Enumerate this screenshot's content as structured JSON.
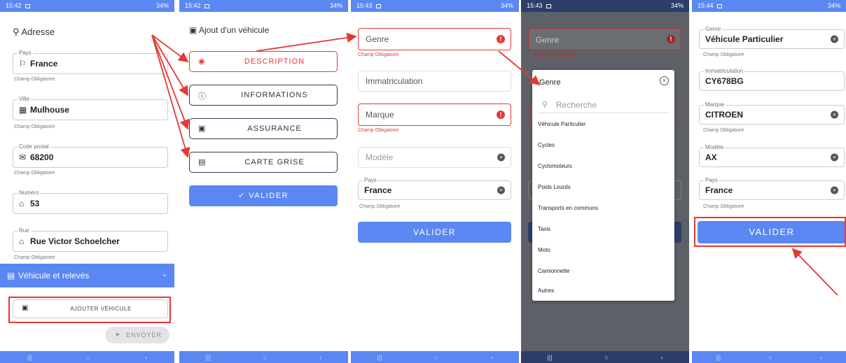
{
  "colors": {
    "primary": "#5b87f2",
    "error": "#e53935",
    "dark_status": "#2c3d6a"
  },
  "screen1": {
    "status": {
      "time": "15:42",
      "right": "34%"
    },
    "section_title": "Adresse",
    "pays": {
      "label": "Pays",
      "value": "France",
      "icon": "flag-icon",
      "hint": "Champ Obligatoire"
    },
    "ville": {
      "label": "Ville",
      "value": "Mulhouse",
      "icon": "building-icon",
      "hint": "Champ Obligatoire"
    },
    "code_postal": {
      "label": "Code postal",
      "value": "68200",
      "icon": "mail-icon",
      "hint": "Champ Obligatoire"
    },
    "numero": {
      "label": "Numéro",
      "value": "53",
      "icon": "home-icon"
    },
    "rue": {
      "label": "Rue",
      "value": "Rue Victor Schoelcher",
      "icon": "home-icon",
      "hint": "Champ Obligatoire"
    },
    "vehicle_section": "Véhicule et relevés",
    "add_vehicle_button": "AJOUTER VÉHICULE",
    "send_button": "ENVOYER"
  },
  "screen2": {
    "status": {
      "time": "15:42",
      "right": "34%"
    },
    "title": "Ajout d'un véhicule",
    "menu": [
      {
        "label": "DESCRIPTION",
        "icon": "eye-icon",
        "active": true
      },
      {
        "label": "INFORMATIONS",
        "icon": "info-icon",
        "active": false
      },
      {
        "label": "ASSURANCE",
        "icon": "car-icon",
        "active": false
      },
      {
        "label": "CARTE GRISE",
        "icon": "document-icon",
        "active": false
      }
    ],
    "validate_button": "VALIDER"
  },
  "screen3": {
    "status": {
      "time": "15:43",
      "right": "34%"
    },
    "genre": {
      "placeholder": "Genre",
      "error": "Champ Obligatoire"
    },
    "immatriculation": {
      "placeholder": "Immatriculation"
    },
    "marque": {
      "placeholder": "Marque",
      "error": "Champ Obligatoire"
    },
    "modele": {
      "placeholder": "Modèle"
    },
    "pays": {
      "label": "Pays",
      "value": "France",
      "hint": "Champ Obligatoire"
    },
    "validate_button": "VALIDER"
  },
  "screen4": {
    "status": {
      "time": "15:43",
      "right": "34%"
    },
    "background_field": "Genre",
    "background_error": "Champ Obligatoire",
    "dialog_title": "Genre",
    "search_placeholder": "Recherche",
    "options": [
      "Véhicule Particulier",
      "Cycles",
      "Cyclomoteurs",
      "Poids Lourds",
      "Transports en communs",
      "Taxis",
      "Moto",
      "Camionnette",
      "Autres"
    ]
  },
  "screen5": {
    "status": {
      "time": "15:44",
      "right": "34%"
    },
    "genre": {
      "label": "Genre",
      "value": "Véhicule Particulier",
      "hint": "Champ Obligatoire"
    },
    "immatriculation": {
      "label": "Immatriculation",
      "value": "CY678BG"
    },
    "marque": {
      "label": "Marque",
      "value": "CITROEN",
      "hint": "Champ Obligatoire"
    },
    "modele": {
      "label": "Modèle",
      "value": "AX"
    },
    "pays": {
      "label": "Pays",
      "value": "France",
      "hint": "Champ Obligatoire"
    },
    "validate_button": "VALIDER"
  }
}
